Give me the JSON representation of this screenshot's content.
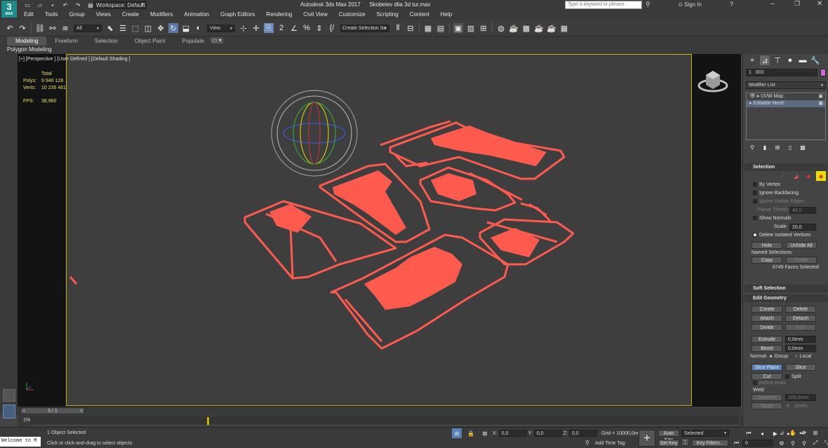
{
  "title": {
    "app_icon": "3",
    "app_icon_sub": "MAX",
    "workspace": "Workspace: Default",
    "app_name": "Autodesk 3ds Max 2017",
    "file_name": "Skobelev dlia 3d tur.max",
    "search_placeholder": "Type a keyword or phrase",
    "sign_in": "Sign In"
  },
  "menu": [
    "Edit",
    "Tools",
    "Group",
    "Views",
    "Create",
    "Modifiers",
    "Animation",
    "Graph Editors",
    "Rendering",
    "Civil View",
    "Customize",
    "Scripting",
    "Content",
    "Help"
  ],
  "toolbar": {
    "selection_filter": "All",
    "ref_coord": "View",
    "named_selection": "Create Selection Se"
  },
  "ribbon": {
    "tabs": [
      "Modeling",
      "Freeform",
      "Selection",
      "Object Paint",
      "Populate"
    ],
    "active_tab": "Modeling",
    "sub_label": "Polygon Modeling"
  },
  "viewport": {
    "label": "[+] [Perspective ] [User Defined ] [Default Shading ]",
    "stats": {
      "total_label": "Total",
      "polys_label": "Polys:",
      "polys_value": "9 940 128",
      "verts_label": "Verts:",
      "verts_value": "10 235 461",
      "fps_label": "FPS:",
      "fps_value": "38,960"
    },
    "colors": {
      "geometry": "#ff5a4e",
      "border": "#c8b400",
      "background": "#3e3e3e"
    }
  },
  "command_panel": {
    "object_name": "003",
    "object_color": "#d26ad2",
    "modifier_list": "Modifier List",
    "stack": [
      "UVW Map",
      "Editable Mesh"
    ],
    "selection": {
      "header": "Selection",
      "by_vertex": "By Vertex",
      "ignore_backfacing": "Ignore Backfacing",
      "ignore_visible_edges": "Ignore Visible Edges",
      "planar_thresh_label": "Planar Thresh:",
      "planar_thresh_value": "45,0",
      "show_normals": "Show Normals",
      "scale_label": "Scale:",
      "scale_value": "20,0",
      "delete_isolated": "Delete Isolated Vertices",
      "hide": "Hide",
      "unhide_all": "Unhide All",
      "named_selections": "Named Selections:",
      "copy": "Copy",
      "paste": "Paste",
      "faces_selected": "6749 Faces Selected"
    },
    "soft_selection": "Soft Selection",
    "edit_geometry": {
      "header": "Edit Geometry",
      "create": "Create",
      "delete": "Delete",
      "attach": "Attach",
      "detach": "Detach",
      "divide": "Divide",
      "turn": "Turn",
      "extrude": "Extrude",
      "extrude_value": "0,0mm",
      "bevel": "Bevel",
      "bevel_value": "0,0mm",
      "normal_label": "Normal:",
      "group": "Group",
      "local": "Local",
      "slice_plane": "Slice Plane",
      "slice": "Slice",
      "cut": "Cut",
      "split": "Split",
      "refine_ends": "Refine Ends",
      "weld": "Weld",
      "selected": "Selected",
      "selected_value": "100,0mm",
      "target": "Target",
      "target_value": "4",
      "pixels": "pixels"
    }
  },
  "timeline": {
    "frame": "0 / 1",
    "track_label": "1%"
  },
  "status": {
    "maxscript": "Welcome to M",
    "objects_selected": "1 Object Selected",
    "prompt": "Click or click-and-drag to select objects",
    "x_label": "X:",
    "x_value": "0,0",
    "y_label": "Y:",
    "y_value": "0,0",
    "z_label": "Z:",
    "z_value": "0,0",
    "grid": "Grid = 10000,0mm",
    "add_time_tag": "Add Time Tag",
    "auto_key": "Auto Key",
    "set_key": "Set Key",
    "key_mode": "Selected",
    "key_filters": "Key Filters...",
    "frame_value": "0"
  }
}
